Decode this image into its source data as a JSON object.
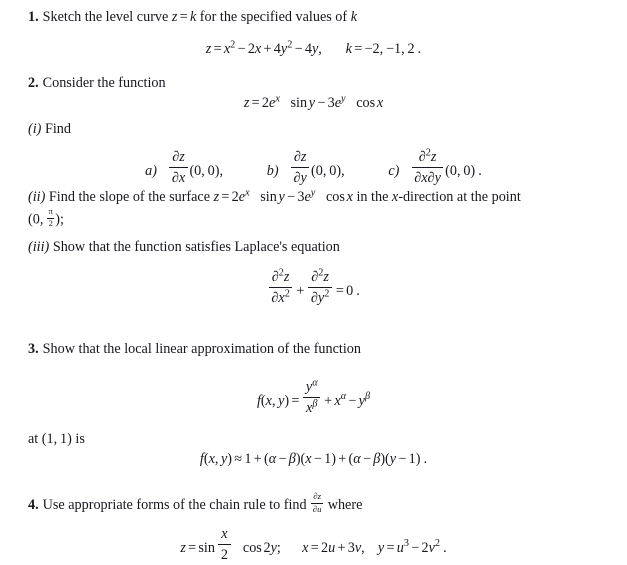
{
  "document": {
    "type": "calculus-problem-set",
    "text_color": "#17171f",
    "background_color": "#ffffff"
  },
  "problems": [
    {
      "number": "1.",
      "prompt_pre": "Sketch the level curve ",
      "prompt_math": "z = k",
      "prompt_post": " for the specified values of ",
      "prompt_var": "k",
      "equation": {
        "lhs": "z",
        "rel": "=",
        "terms": "x² − 2x + 4y² − 4y",
        "k_label": "k",
        "k_values": "−2, −1, 2",
        "trailing": "."
      }
    },
    {
      "number": "2.",
      "prompt": "Consider the function",
      "function": {
        "lhs": "z",
        "rel": "=",
        "rhs": "2e^x sin y − 3e^y cos x"
      },
      "parts": [
        {
          "roman": "(i)",
          "text": "Find",
          "items": [
            {
              "label": "a)",
              "expr": "∂z/∂x(0,0)",
              "punct": ","
            },
            {
              "label": "b)",
              "expr": "∂z/∂y(0,0)",
              "punct": ","
            },
            {
              "label": "c)",
              "expr": "∂²z/∂x∂y(0,0)",
              "punct": "."
            }
          ]
        },
        {
          "roman": "(ii)",
          "text_pre": "Find the slope of the surface ",
          "text_math": "z = 2e^x sin y − 3e^y cos x",
          "text_mid": " in the ",
          "text_dir": "x",
          "text_post": "-direction at the point",
          "point": "(0, π/2);"
        },
        {
          "roman": "(iii)",
          "text": "Show that the function satisfies Laplace's equation",
          "equation": "∂²z/∂x² + ∂²z/∂y² = 0 ."
        }
      ]
    },
    {
      "number": "3.",
      "prompt": "Show that the local linear approximation of the function",
      "function": "f(x, y) = y^α/x^β + x^α − y^β",
      "at_text_pre": "at ",
      "at_point": "(1, 1)",
      "at_text_post": " is",
      "approximation": "f(x, y) ≈ 1 + (α − β)(x − 1) + (α − β)(y − 1) ."
    },
    {
      "number": "4.",
      "prompt_pre": "Use appropriate forms of the chain rule to find ",
      "prompt_frac": "∂z/∂u",
      "prompt_post": " where",
      "equation": "z = sin(x/2) cos 2y;   x = 2u + 3v,  y = u³ − 2v² ."
    }
  ],
  "symbols": {
    "partial": "∂",
    "minus": "−",
    "equals": "=",
    "approx": "≈",
    "plus": "+",
    "alpha": "α",
    "beta": "β",
    "pi": "π",
    "zero": "0",
    "one": "1",
    "two": "2",
    "three": "3",
    "four": "4",
    "comma": ",",
    "period": ".",
    "semicolon": ";",
    "lparen": "(",
    "rparen": ")"
  },
  "labels": {
    "p1_line1_pre": "Sketch the level curve",
    "p1_line1_post": "for the specified values of",
    "p2_line1": "Consider the function",
    "p2_i_find": "Find",
    "p2_ii_pre": "Find the slope of the surface",
    "p2_ii_mid": "in the",
    "p2_ii_post": "-direction at the point",
    "p2_iii": "Show that the function satisfies Laplace's equation",
    "p3_line1": "Show that the local linear approximation of the function",
    "p3_at": "at",
    "p3_is": "is",
    "p4_pre": "Use appropriate forms of the chain rule to find",
    "p4_post": "where",
    "roman_i": "(i)",
    "roman_ii": "(ii)",
    "roman_iii": "(iii)",
    "item_a": "a)",
    "item_b": "b)",
    "item_c": "c)",
    "num1": "1.",
    "num2": "2.",
    "num3": "3.",
    "num4": "4."
  },
  "math_tokens": {
    "z": "z",
    "k": "k",
    "x": "x",
    "y": "y",
    "u": "u",
    "v": "v",
    "f": "f",
    "e": "e",
    "sin": "sin",
    "cos": "cos",
    "eq": "=",
    "plus": "+",
    "minus": "−",
    "approx": "≈",
    "coef2": "2",
    "coef3": "3",
    "coef4": "4",
    "exp2": "2",
    "exp3": "3",
    "kvals": "−2, −1, 2",
    "point00": "(0, 0)",
    "point11": "(1, 1)",
    "rhs0": "0"
  }
}
